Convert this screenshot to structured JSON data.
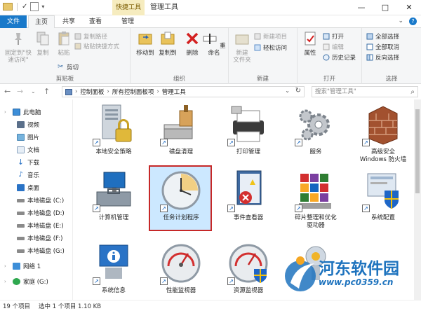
{
  "titlebar": {
    "context_tab": "快捷工具",
    "window_title": "管理工具",
    "buttons": [
      "—",
      "□",
      "✕"
    ]
  },
  "tabs": {
    "file": "文件",
    "items": [
      "主页",
      "共享",
      "查看",
      "管理"
    ],
    "active": "主页"
  },
  "ribbon": {
    "clipboard": {
      "label": "剪贴板",
      "pin": "固定到\"快速访问\"",
      "copy": "复制",
      "paste": "粘贴",
      "copy_path": "复制路径",
      "paste_shortcut": "粘贴快捷方式",
      "cut": "剪切"
    },
    "organize": {
      "label": "组织",
      "move_to": "移动到",
      "copy_to": "复制到",
      "delete": "删除",
      "rename": "重命名"
    },
    "new": {
      "label": "新建",
      "new_folder": "新建\n文件夹",
      "new_item": "新建项目",
      "easy_access": "轻松访问"
    },
    "open": {
      "label": "打开",
      "properties": "属性",
      "open": "打开",
      "edit": "编辑",
      "history": "历史记录"
    },
    "select": {
      "label": "选择",
      "select_all": "全部选择",
      "select_none": "全部取消",
      "invert": "反向选择"
    }
  },
  "address": {
    "crumbs": [
      "控制面板",
      "所有控制面板项",
      "管理工具"
    ],
    "search_placeholder": "搜索\"管理工具\""
  },
  "nav": {
    "items": [
      {
        "label": "此电脑",
        "level": 1
      },
      {
        "label": "视频",
        "level": 2
      },
      {
        "label": "图片",
        "level": 2
      },
      {
        "label": "文档",
        "level": 2
      },
      {
        "label": "下载",
        "level": 2
      },
      {
        "label": "音乐",
        "level": 2
      },
      {
        "label": "桌面",
        "level": 2
      },
      {
        "label": "本地磁盘 (C:)",
        "level": 2
      },
      {
        "label": "本地磁盘 (D:)",
        "level": 2
      },
      {
        "label": "本地磁盘 (E:)",
        "level": 2
      },
      {
        "label": "本地磁盘 (F:)",
        "level": 2
      },
      {
        "label": "本地磁盘 (G:)",
        "level": 2
      },
      {
        "label": "网络 1",
        "level": 1
      },
      {
        "label": "家庭 (G:)",
        "level": 1
      }
    ]
  },
  "items": [
    {
      "label": "本地安全策略",
      "icon": "server-lock-icon"
    },
    {
      "label": "磁盘清理",
      "icon": "disk-cleanup-icon"
    },
    {
      "label": "打印管理",
      "icon": "printer-icon"
    },
    {
      "label": "服务",
      "icon": "gears-icon"
    },
    {
      "label": "高级安全\nWindows 防火墙",
      "icon": "firewall-icon"
    },
    {
      "label": "计算机管理",
      "icon": "computer-management-icon"
    },
    {
      "label": "任务计划程序",
      "icon": "clock-icon",
      "selected": true
    },
    {
      "label": "事件查看器",
      "icon": "event-viewer-icon"
    },
    {
      "label": "碎片整理和优化\n驱动器",
      "icon": "defrag-icon"
    },
    {
      "label": "系统配置",
      "icon": "system-config-icon"
    },
    {
      "label": "系统信息",
      "icon": "system-info-icon"
    },
    {
      "label": "性能监视器",
      "icon": "gauge-icon"
    },
    {
      "label": "资源监视器",
      "icon": "gauge-shield-icon"
    },
    {
      "label": "",
      "icon": "partial-icon"
    }
  ],
  "status": {
    "count": "19 个项目",
    "selected": "选中 1 个项目 1.10 KB"
  },
  "watermark": {
    "title": "河东软件园",
    "url": "www.pc0359.cn"
  },
  "colors": {
    "file_tab": "#1979ca",
    "context_tab": "#f6ecbf",
    "selection": "#cce8ff",
    "selection_border": "#c62828",
    "watermark": "#1e73be"
  }
}
